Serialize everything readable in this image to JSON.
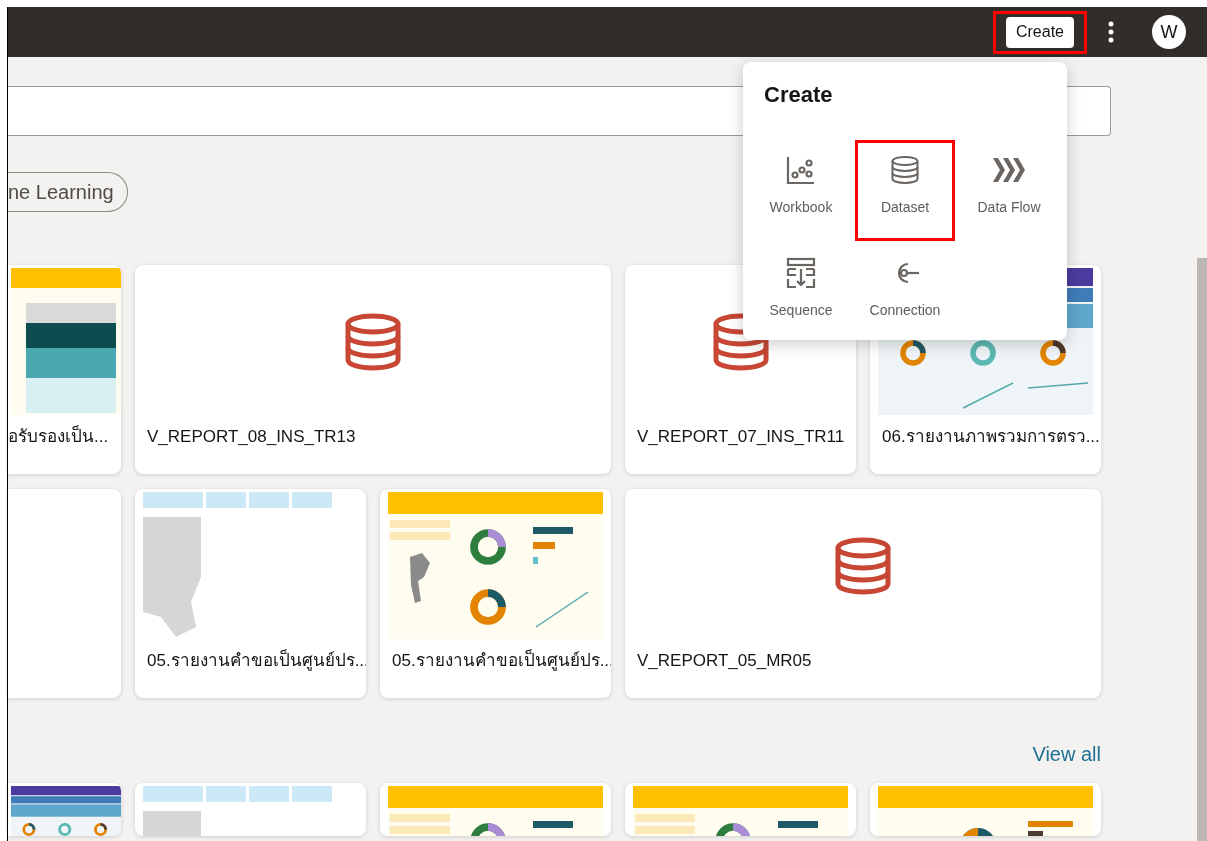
{
  "topbar": {
    "create_button": {
      "label": "Create",
      "highlighted": true
    },
    "avatar": "W"
  },
  "filter_chips": [
    {
      "label": "ne Learning"
    }
  ],
  "card_rows": [
    [
      {
        "kind": "table-map",
        "title": "อรับรองเป็น..."
      },
      {
        "kind": "dataset",
        "wide": true,
        "title": "V_REPORT_08_INS_TR13"
      },
      {
        "kind": "dataset",
        "wide": false,
        "title": "V_REPORT_07_INS_TR11"
      },
      {
        "kind": "summary",
        "title": "06.รายงานภาพรวมการตรว..."
      }
    ],
    [
      {
        "kind": "blank"
      },
      {
        "kind": "map",
        "title": "05.รายงานคำขอเป็นศูนย์ปร..."
      },
      {
        "kind": "donut",
        "title": "05.รายงานคำขอเป็นศูนย์ปร..."
      },
      {
        "kind": "dataset",
        "wide": true,
        "title": "V_REPORT_05_MR05"
      }
    ]
  ],
  "view_all": "View all",
  "more_cards": [
    {
      "kind": "summary"
    },
    {
      "kind": "map"
    },
    {
      "kind": "donut"
    },
    {
      "kind": "donut-map"
    },
    {
      "kind": "pie"
    }
  ],
  "create_menu": {
    "title": "Create",
    "items": [
      {
        "kind": "workbook",
        "label": "Workbook",
        "highlighted": false
      },
      {
        "kind": "dataset",
        "label": "Dataset",
        "highlighted": true
      },
      {
        "kind": "dataflow",
        "label": "Data Flow",
        "highlighted": false
      },
      {
        "kind": "sequence",
        "label": "Sequence",
        "highlighted": false
      },
      {
        "kind": "connection",
        "label": "Connection",
        "highlighted": false
      }
    ]
  }
}
